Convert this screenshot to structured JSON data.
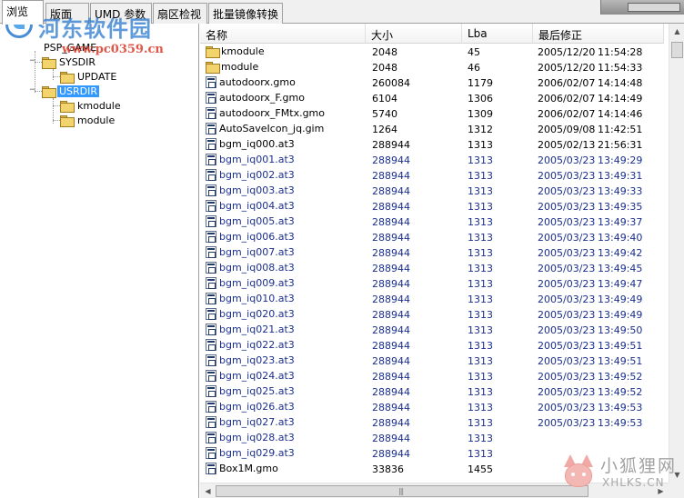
{
  "tabs": [
    {
      "label": "浏览",
      "active": true
    },
    {
      "label": "版面",
      "active": false
    },
    {
      "label": "UMD 参数",
      "active": false
    },
    {
      "label": "扇区检视",
      "active": false
    },
    {
      "label": "批量镜像转换",
      "active": false
    }
  ],
  "tree": {
    "root": "PSP_GAME",
    "nodes": [
      {
        "label": "SYSDIR",
        "expander": "−"
      },
      {
        "label": "UPDATE"
      },
      {
        "label": "USRDIR",
        "expander": "−",
        "selected": true
      },
      {
        "label": "kmodule"
      },
      {
        "label": "module"
      }
    ]
  },
  "columns": [
    "名称",
    "大小",
    "Lba",
    "最后修正"
  ],
  "files": [
    {
      "icon": "folder-icon",
      "name": "kmodule",
      "size": "2048",
      "lba": "45",
      "date": "2005/12/20",
      "time": "11:54:28",
      "color": "black"
    },
    {
      "icon": "folder-icon",
      "name": "module",
      "size": "2048",
      "lba": "46",
      "date": "2005/12/20",
      "time": "11:54:33",
      "color": "black"
    },
    {
      "icon": "file-icon",
      "name": "autodoorx.gmo",
      "size": "260084",
      "lba": "1179",
      "date": "2006/02/07",
      "time": "14:14:48",
      "color": "black"
    },
    {
      "icon": "file-icon",
      "name": "autodoorx_F.gmo",
      "size": "6104",
      "lba": "1306",
      "date": "2006/02/07",
      "time": "14:14:49",
      "color": "black"
    },
    {
      "icon": "file-icon",
      "name": "autodoorx_FMtx.gmo",
      "size": "5740",
      "lba": "1309",
      "date": "2006/02/07",
      "time": "14:14:46",
      "color": "black"
    },
    {
      "icon": "file-icon",
      "name": "AutoSaveIcon_jq.gim",
      "size": "1264",
      "lba": "1312",
      "date": "2005/09/08",
      "time": "11:42:51",
      "color": "black"
    },
    {
      "icon": "file-icon",
      "name": "bgm_iq000.at3",
      "size": "288944",
      "lba": "1313",
      "date": "2005/02/13",
      "time": "21:56:31",
      "color": "black"
    },
    {
      "icon": "file-icon",
      "name": "bgm_iq001.at3",
      "size": "288944",
      "lba": "1313",
      "date": "2005/03/23",
      "time": "13:49:29",
      "color": "blue"
    },
    {
      "icon": "file-icon",
      "name": "bgm_iq002.at3",
      "size": "288944",
      "lba": "1313",
      "date": "2005/03/23",
      "time": "13:49:31",
      "color": "blue"
    },
    {
      "icon": "file-icon",
      "name": "bgm_iq003.at3",
      "size": "288944",
      "lba": "1313",
      "date": "2005/03/23",
      "time": "13:49:33",
      "color": "blue"
    },
    {
      "icon": "file-icon",
      "name": "bgm_iq004.at3",
      "size": "288944",
      "lba": "1313",
      "date": "2005/03/23",
      "time": "13:49:35",
      "color": "blue"
    },
    {
      "icon": "file-icon",
      "name": "bgm_iq005.at3",
      "size": "288944",
      "lba": "1313",
      "date": "2005/03/23",
      "time": "13:49:37",
      "color": "blue"
    },
    {
      "icon": "file-icon",
      "name": "bgm_iq006.at3",
      "size": "288944",
      "lba": "1313",
      "date": "2005/03/23",
      "time": "13:49:40",
      "color": "blue"
    },
    {
      "icon": "file-icon",
      "name": "bgm_iq007.at3",
      "size": "288944",
      "lba": "1313",
      "date": "2005/03/23",
      "time": "13:49:42",
      "color": "blue"
    },
    {
      "icon": "file-icon",
      "name": "bgm_iq008.at3",
      "size": "288944",
      "lba": "1313",
      "date": "2005/03/23",
      "time": "13:49:45",
      "color": "blue"
    },
    {
      "icon": "file-icon",
      "name": "bgm_iq009.at3",
      "size": "288944",
      "lba": "1313",
      "date": "2005/03/23",
      "time": "13:49:47",
      "color": "blue"
    },
    {
      "icon": "file-icon",
      "name": "bgm_iq010.at3",
      "size": "288944",
      "lba": "1313",
      "date": "2005/03/23",
      "time": "13:49:49",
      "color": "blue"
    },
    {
      "icon": "file-icon",
      "name": "bgm_iq020.at3",
      "size": "288944",
      "lba": "1313",
      "date": "2005/03/23",
      "time": "13:49:49",
      "color": "blue"
    },
    {
      "icon": "file-icon",
      "name": "bgm_iq021.at3",
      "size": "288944",
      "lba": "1313",
      "date": "2005/03/23",
      "time": "13:49:50",
      "color": "blue"
    },
    {
      "icon": "file-icon",
      "name": "bgm_iq022.at3",
      "size": "288944",
      "lba": "1313",
      "date": "2005/03/23",
      "time": "13:49:51",
      "color": "blue"
    },
    {
      "icon": "file-icon",
      "name": "bgm_iq023.at3",
      "size": "288944",
      "lba": "1313",
      "date": "2005/03/23",
      "time": "13:49:51",
      "color": "blue"
    },
    {
      "icon": "file-icon",
      "name": "bgm_iq024.at3",
      "size": "288944",
      "lba": "1313",
      "date": "2005/03/23",
      "time": "13:49:52",
      "color": "blue"
    },
    {
      "icon": "file-icon",
      "name": "bgm_iq025.at3",
      "size": "288944",
      "lba": "1313",
      "date": "2005/03/23",
      "time": "13:49:52",
      "color": "blue"
    },
    {
      "icon": "file-icon",
      "name": "bgm_iq026.at3",
      "size": "288944",
      "lba": "1313",
      "date": "2005/03/23",
      "time": "13:49:53",
      "color": "blue"
    },
    {
      "icon": "file-icon",
      "name": "bgm_iq027.at3",
      "size": "288944",
      "lba": "1313",
      "date": "2005/03/23",
      "time": "13:49:53",
      "color": "blue"
    },
    {
      "icon": "file-icon",
      "name": "bgm_iq028.at3",
      "size": "288944",
      "lba": "1313",
      "date": "",
      "time": "",
      "color": "blue"
    },
    {
      "icon": "file-icon",
      "name": "bgm_iq029.at3",
      "size": "288944",
      "lba": "1313",
      "date": "",
      "time": "",
      "color": "blue"
    },
    {
      "icon": "file-icon",
      "name": "Box1M.gmo",
      "size": "33836",
      "lba": "1455",
      "date": "",
      "time": "",
      "color": "black"
    }
  ],
  "watermarks": {
    "site_title": "河东软件园",
    "site_url": "www.pc0359.cn",
    "brand": "小狐狸网",
    "brand_site": "XHLKS.CN"
  },
  "colors": {
    "selection": "#3399ff",
    "blue_text": "#1a2e8c"
  }
}
